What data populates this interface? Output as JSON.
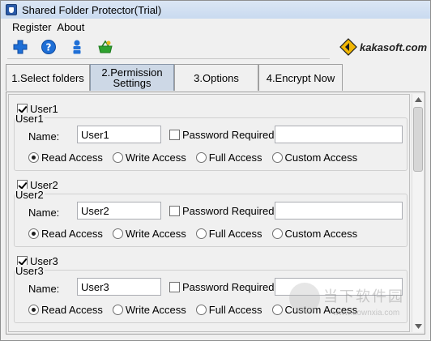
{
  "window": {
    "title": "Shared Folder Protector(Trial)"
  },
  "menu": {
    "items": [
      "Register",
      "About"
    ]
  },
  "toolbar": {
    "buttons": [
      {
        "icon": "plus-icon",
        "color": "#1f6fd6"
      },
      {
        "icon": "help-icon",
        "color": "#1f6fd6"
      },
      {
        "icon": "user-icon",
        "color": "#1f6fd6"
      },
      {
        "icon": "basket-icon",
        "color": "#2fa22f"
      }
    ]
  },
  "brand": {
    "text": "kakasoft.com",
    "logo_colors": [
      "#f2b705",
      "#1d1d1d"
    ]
  },
  "tabs": [
    {
      "label": "1.Select folders",
      "active": false
    },
    {
      "label": "2.Permission Settings",
      "active": true
    },
    {
      "label": "3.Options",
      "active": false
    },
    {
      "label": "4.Encrypt Now",
      "active": false
    }
  ],
  "users": [
    {
      "checkbox_label": "User1",
      "checked": true,
      "group_label": "User1",
      "name_label": "Name:",
      "name_value": "User1",
      "password_label": "Password Required",
      "password_required": false,
      "password_value": "",
      "access_options": [
        "Read Access",
        "Write Access",
        "Full Access",
        "Custom Access"
      ],
      "selected": "Read Access"
    },
    {
      "checkbox_label": "User2",
      "checked": true,
      "group_label": "User2",
      "name_label": "Name:",
      "name_value": "User2",
      "password_label": "Password Required",
      "password_required": false,
      "password_value": "",
      "access_options": [
        "Read Access",
        "Write Access",
        "Full Access",
        "Custom Access"
      ],
      "selected": "Read Access"
    },
    {
      "checkbox_label": "User3",
      "checked": true,
      "group_label": "User3",
      "name_label": "Name:",
      "name_value": "User3",
      "password_label": "Password Required",
      "password_required": false,
      "password_value": "",
      "access_options": [
        "Read Access",
        "Write Access",
        "Full Access",
        "Custom Access"
      ],
      "selected": "Read Access"
    }
  ],
  "watermark": {
    "text": "当下软件园",
    "url": "www.downxia.com"
  }
}
